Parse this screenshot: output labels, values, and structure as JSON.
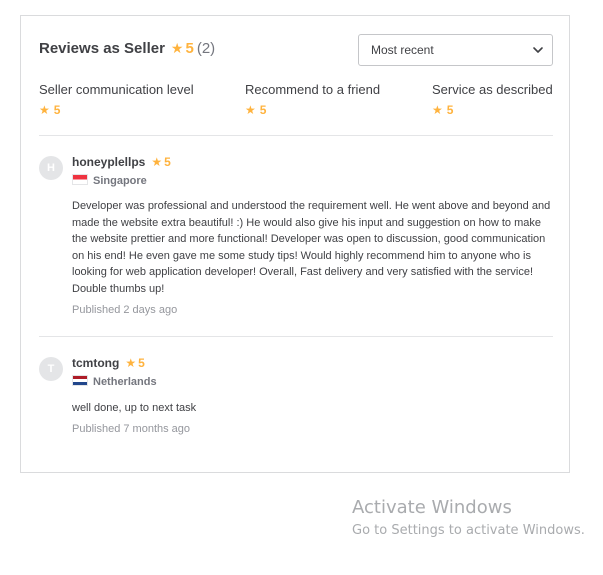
{
  "header": {
    "title": "Reviews as Seller",
    "rating": "5",
    "count": "(2)"
  },
  "sort": {
    "selected": "Most recent"
  },
  "breakdown": [
    {
      "label": "Seller communication level",
      "value": "5"
    },
    {
      "label": "Recommend to a friend",
      "value": "5"
    },
    {
      "label": "Service as described",
      "value": "5"
    }
  ],
  "reviews": [
    {
      "avatar": "H",
      "username": "honeyplellps",
      "rating": "5",
      "country": "Singapore",
      "text": "Developer was professional and understood the requirement well. He went above and beyond and made the website extra beautiful! :) He would also give his input and suggestion on how to make the website prettier and more functional! Developer was open to discussion, good communication on his end! He even gave me some study tips! Would highly recommend him to anyone who is looking for web application developer! Overall, Fast delivery and very satisfied with the service! Double thumbs up!",
      "published": "Published 2 days ago"
    },
    {
      "avatar": "T",
      "username": "tcmtong",
      "rating": "5",
      "country": "Netherlands",
      "text": "well done, up to next task",
      "published": "Published 7 months ago"
    }
  ],
  "watermark": {
    "title": "Activate Windows",
    "subtitle": "Go to Settings to activate Windows."
  },
  "colors": {
    "star": "#ffb33e",
    "text": "#404145",
    "muted": "#74767e",
    "border": "#dadbdd"
  },
  "icons": {
    "star": "star-icon",
    "chevron": "chevron-down-icon"
  }
}
